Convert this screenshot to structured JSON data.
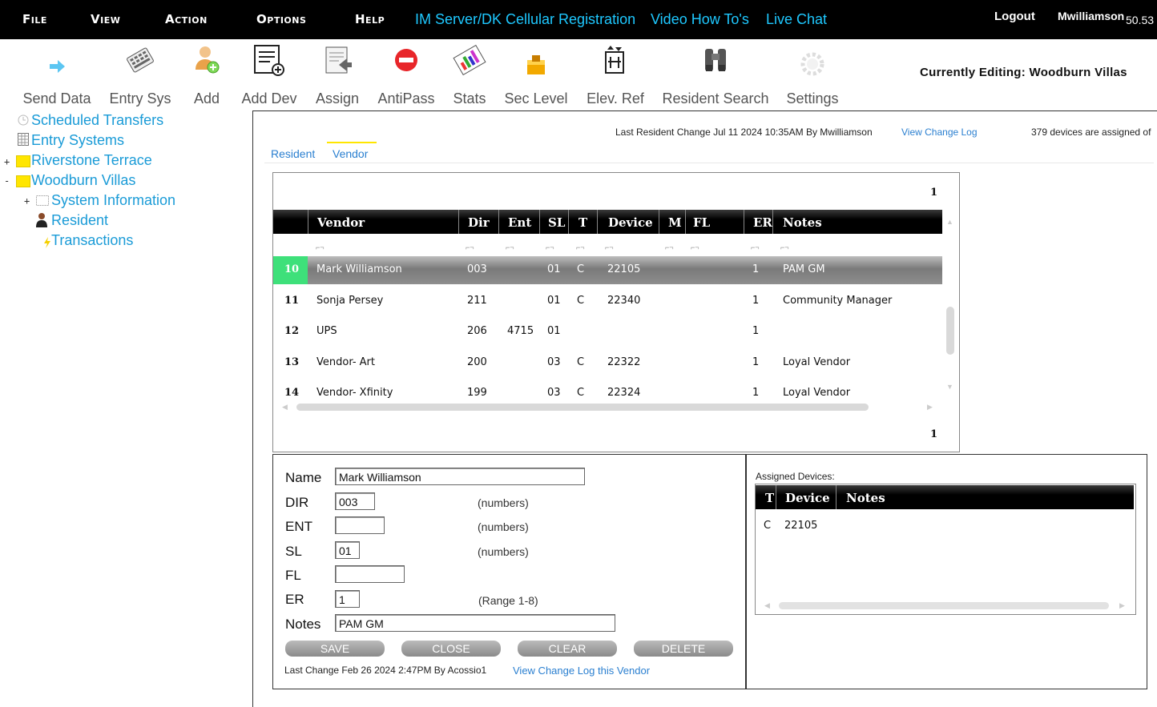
{
  "menu": {
    "file": "File",
    "view": "View",
    "action": "Action",
    "options": "Options",
    "help": "Help",
    "im_server": "IM Server/DK Cellular Registration",
    "video": "Video How To's",
    "chat": "Live Chat",
    "logout": "Logout",
    "user": "Mwilliamson",
    "version": "50.53"
  },
  "toolbar": [
    {
      "label": "Send Data",
      "icon": "arrow-right-icon"
    },
    {
      "label": "Entry Sys",
      "icon": "keypad-icon"
    },
    {
      "label": "Add",
      "icon": "add-user-icon"
    },
    {
      "label": "Add Dev",
      "icon": "add-device-icon"
    },
    {
      "label": "Assign",
      "icon": "assign-icon"
    },
    {
      "label": "AntiPass",
      "icon": "no-entry-icon"
    },
    {
      "label": "Stats",
      "icon": "stats-icon"
    },
    {
      "label": "Sec Level",
      "icon": "security-level-icon"
    },
    {
      "label": "Elev. Ref",
      "icon": "elevator-icon"
    },
    {
      "label": "Resident Search",
      "icon": "binoculars-icon"
    },
    {
      "label": "Settings",
      "icon": "gear-icon"
    }
  ],
  "currently_editing": "Currently Editing: Woodburn Villas",
  "tree": {
    "scheduled": "Scheduled Transfers",
    "entry_systems": "Entry Systems",
    "riverstone": "Riverstone Terrace",
    "woodburn": "Woodburn Villas",
    "sysinfo": "System Information",
    "resident": "Resident",
    "transactions": "Transactions"
  },
  "info": {
    "last_change": "Last Resident Change Jul 11 2024 10:35AM By Mwilliamson",
    "view_log": "View Change Log",
    "devices_assigned": "379 devices are assigned of"
  },
  "tabs": {
    "resident": "Resident",
    "vendor": "Vendor"
  },
  "grid": {
    "page_top": "1",
    "page_bottom": "1",
    "headers": {
      "vendor": "Vendor",
      "dir": "Dir",
      "ent": "Ent",
      "sl": "SL",
      "t": "T",
      "device": "Device",
      "m": "M",
      "fl": "FL",
      "er": "ER",
      "notes": "Notes"
    },
    "rows": [
      {
        "num": "10",
        "vendor": "Mark Williamson",
        "dir": "003",
        "ent": "",
        "sl": "01",
        "t": "C",
        "device": "22105",
        "er": "1",
        "notes": "PAM GM"
      },
      {
        "num": "11",
        "vendor": "Sonja Persey",
        "dir": "211",
        "ent": "",
        "sl": "01",
        "t": "C",
        "device": "22340",
        "er": "1",
        "notes": "Community Manager"
      },
      {
        "num": "12",
        "vendor": "UPS",
        "dir": "206",
        "ent": "4715",
        "sl": "01",
        "t": "",
        "device": "",
        "er": "1",
        "notes": ""
      },
      {
        "num": "13",
        "vendor": "Vendor- Art",
        "dir": "200",
        "ent": "",
        "sl": "03",
        "t": "C",
        "device": "22322",
        "er": "1",
        "notes": "Loyal Vendor"
      },
      {
        "num": "14",
        "vendor": "Vendor- Xfinity",
        "dir": "199",
        "ent": "",
        "sl": "03",
        "t": "C",
        "device": "22324",
        "er": "1",
        "notes": "Loyal Vendor"
      }
    ]
  },
  "form": {
    "name_label": "Name",
    "name": "Mark Williamson",
    "dir_label": "DIR",
    "dir": "003",
    "ent_label": "ENT",
    "ent": "",
    "sl_label": "SL",
    "sl": "01",
    "fl_label": "FL",
    "fl": "",
    "er_label": "ER",
    "er": "1",
    "notes_label": "Notes",
    "notes": "PAM GM",
    "numbers_hint": "(numbers)",
    "range_hint": "(Range 1-8)",
    "save": "SAVE",
    "close": "CLOSE",
    "clear": "CLEAR",
    "delete": "DELETE",
    "last_change": "Last Change Feb 26 2024 2:47PM By Acossio1",
    "view_log": "View Change Log this Vendor"
  },
  "assigned": {
    "title": "Assigned Devices:",
    "headers": {
      "t": "T",
      "device": "Device",
      "notes": "Notes"
    },
    "rows": [
      {
        "t": "C",
        "device": "22105",
        "notes": ""
      }
    ]
  }
}
